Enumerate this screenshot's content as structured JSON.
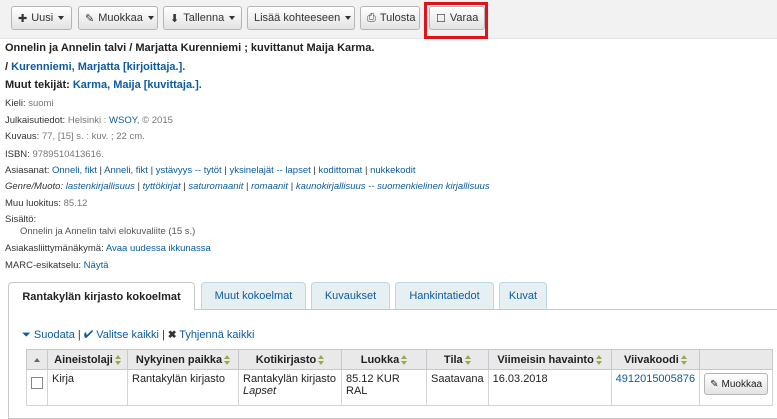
{
  "toolbar": {
    "new_label": "Uusi",
    "edit_label": "Muokkaa",
    "save_label": "Tallenna",
    "add_to_label": "Lisää kohteeseen",
    "print_label": "Tulosta",
    "reserve_label": "Varaa"
  },
  "record": {
    "title": "Onnelin ja Annelin talvi / Marjatta Kurenniemi ; kuvittanut Maija Karma.",
    "author_prefix": "/ ",
    "author_link": "Kurenniemi, Marjatta [kirjoittaja.].",
    "other_authors_label": "Muut tekijät: ",
    "other_authors_link": "Karma, Maija [kuvittaja.].",
    "language_label": "Kieli: ",
    "language_value": "suomi",
    "published_label": "Julkaisutiedot: ",
    "published_place": "Helsinki : ",
    "published_publisher": "WSOY",
    "published_year": ", © 2015",
    "description_label": "Kuvaus: ",
    "description_value": "77, [15] s. : kuv. ; 22 cm.",
    "isbn_label": "ISBN: ",
    "isbn_value": "9789510413616.",
    "subjects_label": "Asiasanat: ",
    "subjects": [
      "Onneli, fikt",
      "Anneli, fikt",
      "ystävyys -- tytöt",
      "yksinelajät -- lapset",
      "kodittomat",
      "nukkekodit"
    ],
    "genre_label": "Genre/Muoto: ",
    "genres": [
      "lastenkirjallisuus",
      "tyttökirjat",
      "saturomaanit",
      "romaanit",
      "kaunokirjallisuus -- suomenkielinen kirjallisuus"
    ],
    "other_class_label": "Muu luokitus: ",
    "other_class_value": "85.12",
    "contents_label": "Sisältö:",
    "contents_value": "Onnelin ja Annelin talvi elokuvaliite (15 s.)",
    "opac_label": "Asiakasliittymänäkymä: ",
    "opac_link": "Avaa uudessa ikkunassa",
    "marc_label": "MARC-esikatselu: ",
    "marc_link": "Näytä"
  },
  "tabs": [
    "Rantakylän kirjasto kokoelmat",
    "Muut kokoelmat",
    "Kuvaukset",
    "Hankintatiedot",
    "Kuvat"
  ],
  "holdings": {
    "filter_label": "Suodata",
    "select_all_label": "Valitse kaikki",
    "clear_all_label": "Tyhjennä kaikki",
    "columns": [
      "Aineistolaji",
      "Nykyinen paikka",
      "Kotikirjasto",
      "Luokka",
      "Tila",
      "Viimeisin havainto",
      "Viivakoodi"
    ],
    "rows": [
      {
        "type": "Kirja",
        "current_location": "Rantakylän kirjasto",
        "home_library": "Rantakylän kirjasto",
        "home_location": "Lapset",
        "call_number": "85.12 KUR RAL",
        "status": "Saatavana",
        "last_seen": "16.03.2018",
        "barcode": "4912015005876",
        "edit_label": "Muokkaa"
      }
    ]
  },
  "colors": {
    "link": "#0c5ba0",
    "highlight": "#e0131a"
  }
}
